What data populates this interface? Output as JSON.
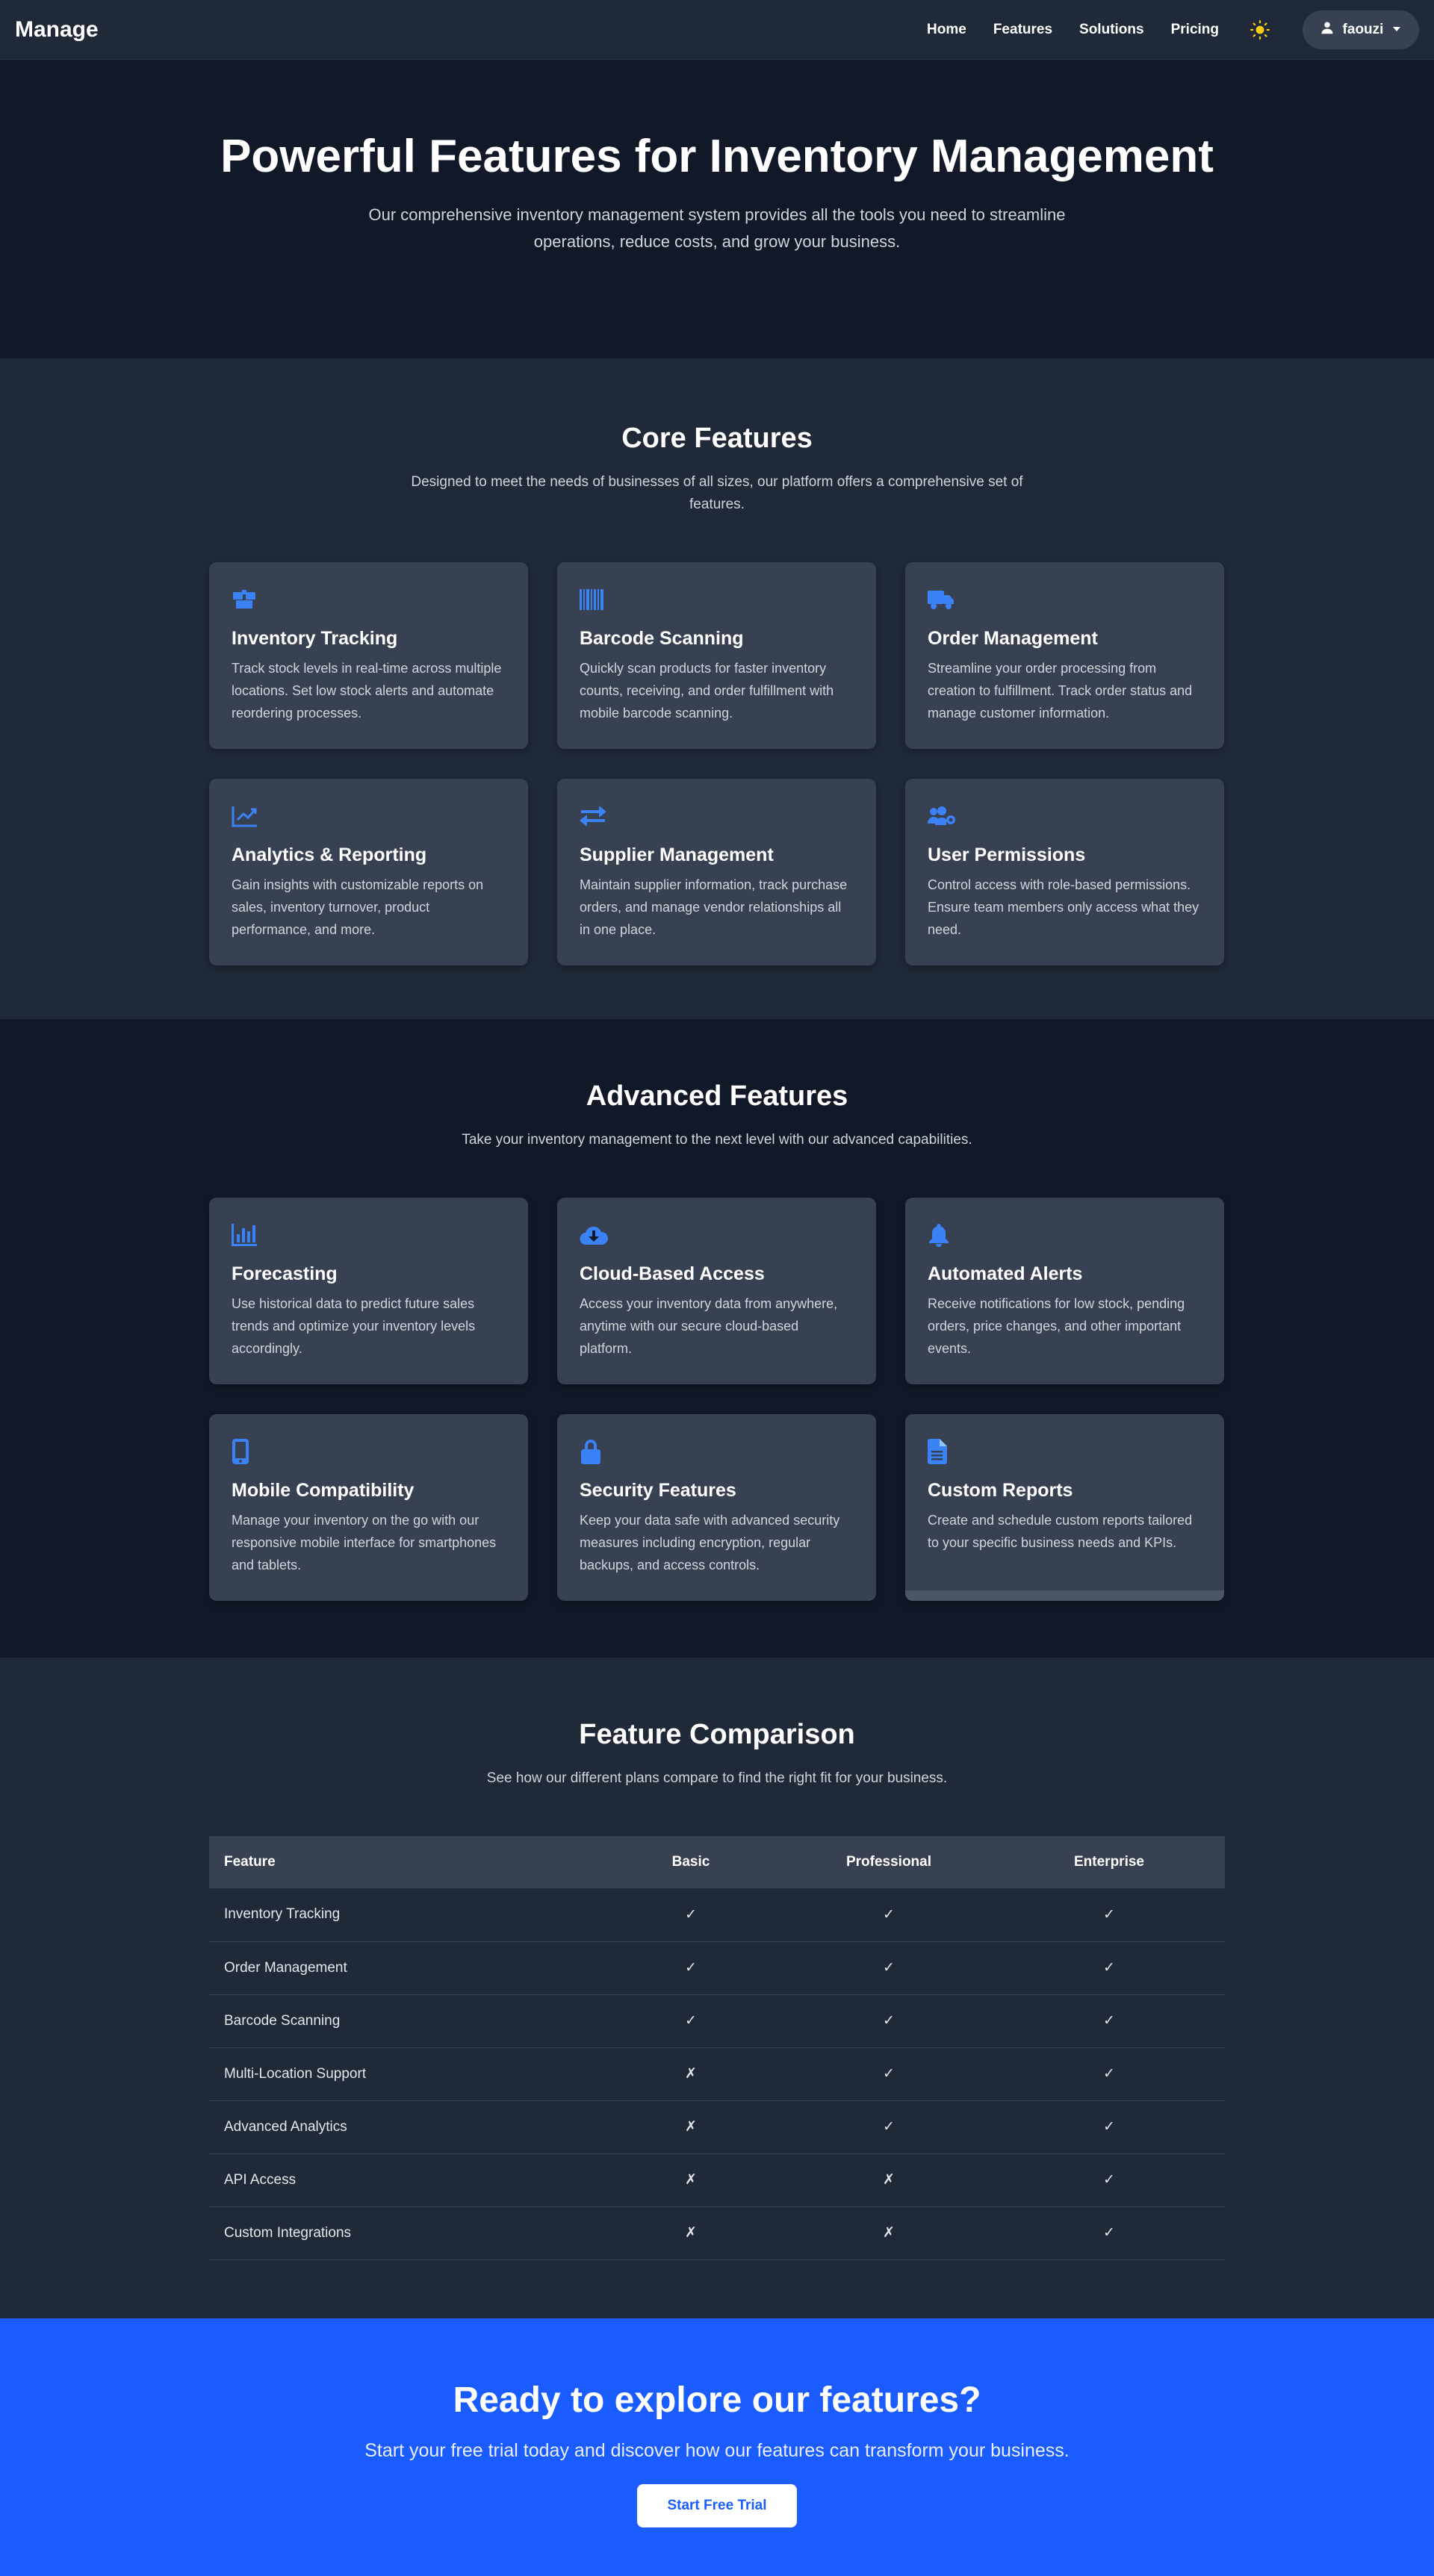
{
  "nav": {
    "brand": "Manage",
    "links": [
      "Home",
      "Features",
      "Solutions",
      "Pricing"
    ],
    "user": "faouzi",
    "theme_icon": "sun-icon",
    "accent_color": "#facc15"
  },
  "hero": {
    "title": "Powerful Features for Inventory Management",
    "subtitle": "Our comprehensive inventory management system provides all the tools you need to streamline operations, reduce costs, and grow your business."
  },
  "core": {
    "title": "Core Features",
    "subtitle": "Designed to meet the needs of businesses of all sizes, our platform offers a comprehensive set of features.",
    "cards": [
      {
        "icon": "boxes-icon",
        "title": "Inventory Tracking",
        "text": "Track stock levels in real-time across multiple locations. Set low stock alerts and automate reordering processes."
      },
      {
        "icon": "barcode-icon",
        "title": "Barcode Scanning",
        "text": "Quickly scan products for faster inventory counts, receiving, and order fulfillment with mobile barcode scanning."
      },
      {
        "icon": "truck-icon",
        "title": "Order Management",
        "text": "Streamline your order processing from creation to fulfillment. Track order status and manage customer information."
      },
      {
        "icon": "chart-line-icon",
        "title": "Analytics & Reporting",
        "text": "Gain insights with customizable reports on sales, inventory turnover, product performance, and more."
      },
      {
        "icon": "exchange-icon",
        "title": "Supplier Management",
        "text": "Maintain supplier information, track purchase orders, and manage vendor relationships all in one place."
      },
      {
        "icon": "users-cog-icon",
        "title": "User Permissions",
        "text": "Control access with role-based permissions. Ensure team members only access what they need."
      }
    ]
  },
  "advanced": {
    "title": "Advanced Features",
    "subtitle": "Take your inventory management to the next level with our advanced capabilities.",
    "cards": [
      {
        "icon": "chart-bar-icon",
        "title": "Forecasting",
        "text": "Use historical data to predict future sales trends and optimize your inventory levels accordingly."
      },
      {
        "icon": "cloud-download-icon",
        "title": "Cloud-Based Access",
        "text": "Access your inventory data from anywhere, anytime with our secure cloud-based platform."
      },
      {
        "icon": "bell-icon",
        "title": "Automated Alerts",
        "text": "Receive notifications for low stock, pending orders, price changes, and other important events."
      },
      {
        "icon": "mobile-icon",
        "title": "Mobile Compatibility",
        "text": "Manage your inventory on the go with our responsive mobile interface for smartphones and tablets."
      },
      {
        "icon": "lock-icon",
        "title": "Security Features",
        "text": "Keep your data safe with advanced security measures including encryption, regular backups, and access controls."
      },
      {
        "icon": "file-icon",
        "title": "Custom Reports",
        "text": "Create and schedule custom reports tailored to your specific business needs and KPIs."
      }
    ]
  },
  "comparison": {
    "title": "Feature Comparison",
    "subtitle": "See how our different plans compare to find the right fit for your business.",
    "headers": [
      "Feature",
      "Basic",
      "Professional",
      "Enterprise"
    ],
    "rows": [
      {
        "feature": "Inventory Tracking",
        "values": [
          "✓",
          "✓",
          "✓"
        ]
      },
      {
        "feature": "Order Management",
        "values": [
          "✓",
          "✓",
          "✓"
        ]
      },
      {
        "feature": "Barcode Scanning",
        "values": [
          "✓",
          "✓",
          "✓"
        ]
      },
      {
        "feature": "Multi-Location Support",
        "values": [
          "✗",
          "✓",
          "✓"
        ]
      },
      {
        "feature": "Advanced Analytics",
        "values": [
          "✗",
          "✓",
          "✓"
        ]
      },
      {
        "feature": "API Access",
        "values": [
          "✗",
          "✗",
          "✓"
        ]
      },
      {
        "feature": "Custom Integrations",
        "values": [
          "✗",
          "✗",
          "✓"
        ]
      }
    ]
  },
  "cta": {
    "title": "Ready to explore our features?",
    "subtitle": "Start your free trial today and discover how our features can transform your business.",
    "button": "Start Free Trial"
  },
  "colors": {
    "icon_blue": "#3b82f6",
    "check_green": "#22c55e",
    "cross_red": "#ef4444",
    "cta_blue": "#1a5cff"
  }
}
